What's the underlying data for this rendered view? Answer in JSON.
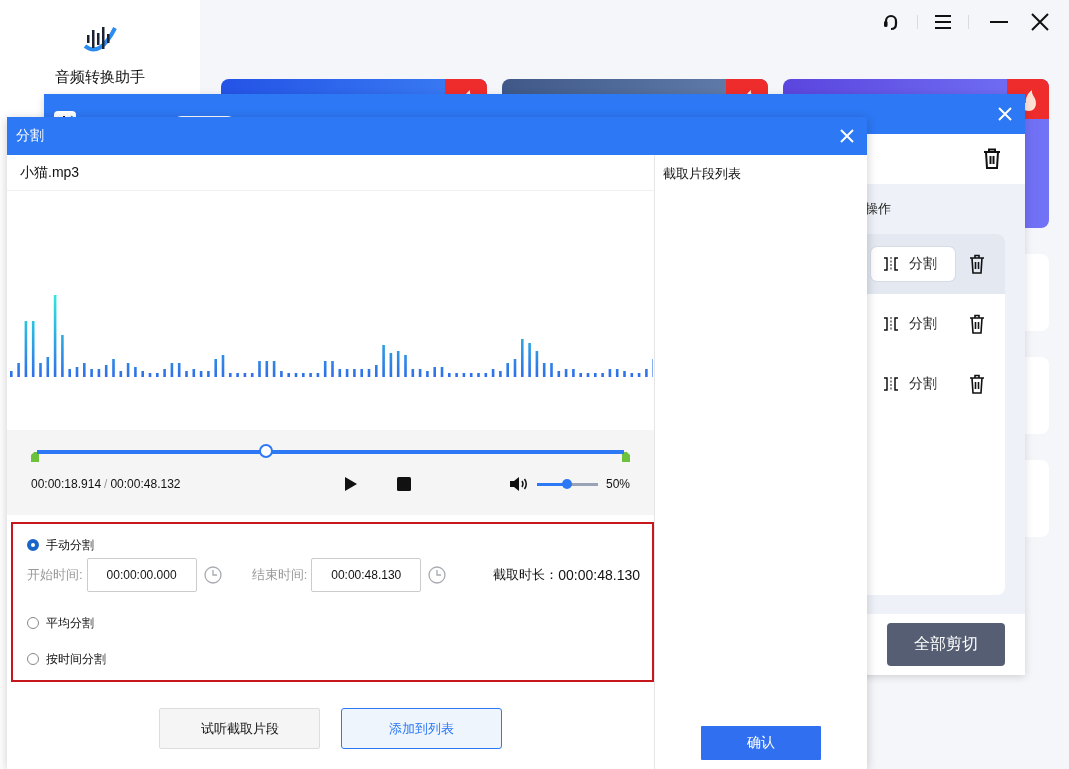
{
  "app": {
    "name": "音频转换助手"
  },
  "feature_cards": [
    {
      "kind": "blue",
      "hot": true
    },
    {
      "kind": "slate",
      "hot": true
    },
    {
      "kind": "violet",
      "hot": true
    }
  ],
  "cut_window": {
    "column_header": "操作",
    "rows": [
      {
        "action": "分割",
        "selected": true
      },
      {
        "action": "分割",
        "selected": false
      },
      {
        "action": "分割",
        "selected": false
      }
    ],
    "cut_all_button": "全部剪切"
  },
  "split_dialog": {
    "title": "分割",
    "file_name": "小猫.mp3",
    "playback": {
      "level": 0.39,
      "current_time": "00:00:18.914",
      "separator": "/",
      "total_time": "00:00:48.132"
    },
    "volume": {
      "level": 0.5,
      "reading": "50%"
    },
    "modes": [
      {
        "label": "手动分割",
        "selected": true
      },
      {
        "label": "平均分割",
        "selected": false
      },
      {
        "label": "按时间分割",
        "selected": false
      }
    ],
    "start_label": "开始时间:",
    "start_value": "00:00:00.000",
    "end_label": "结束时间:",
    "end_value": "00:00:48.130",
    "duration_label": "截取时长：",
    "duration_value": "00:00:48.130",
    "preview_button": "试听截取片段",
    "add_button": "添加到列表",
    "clip_list_title": "截取片段列表",
    "confirm_button": "确认"
  }
}
